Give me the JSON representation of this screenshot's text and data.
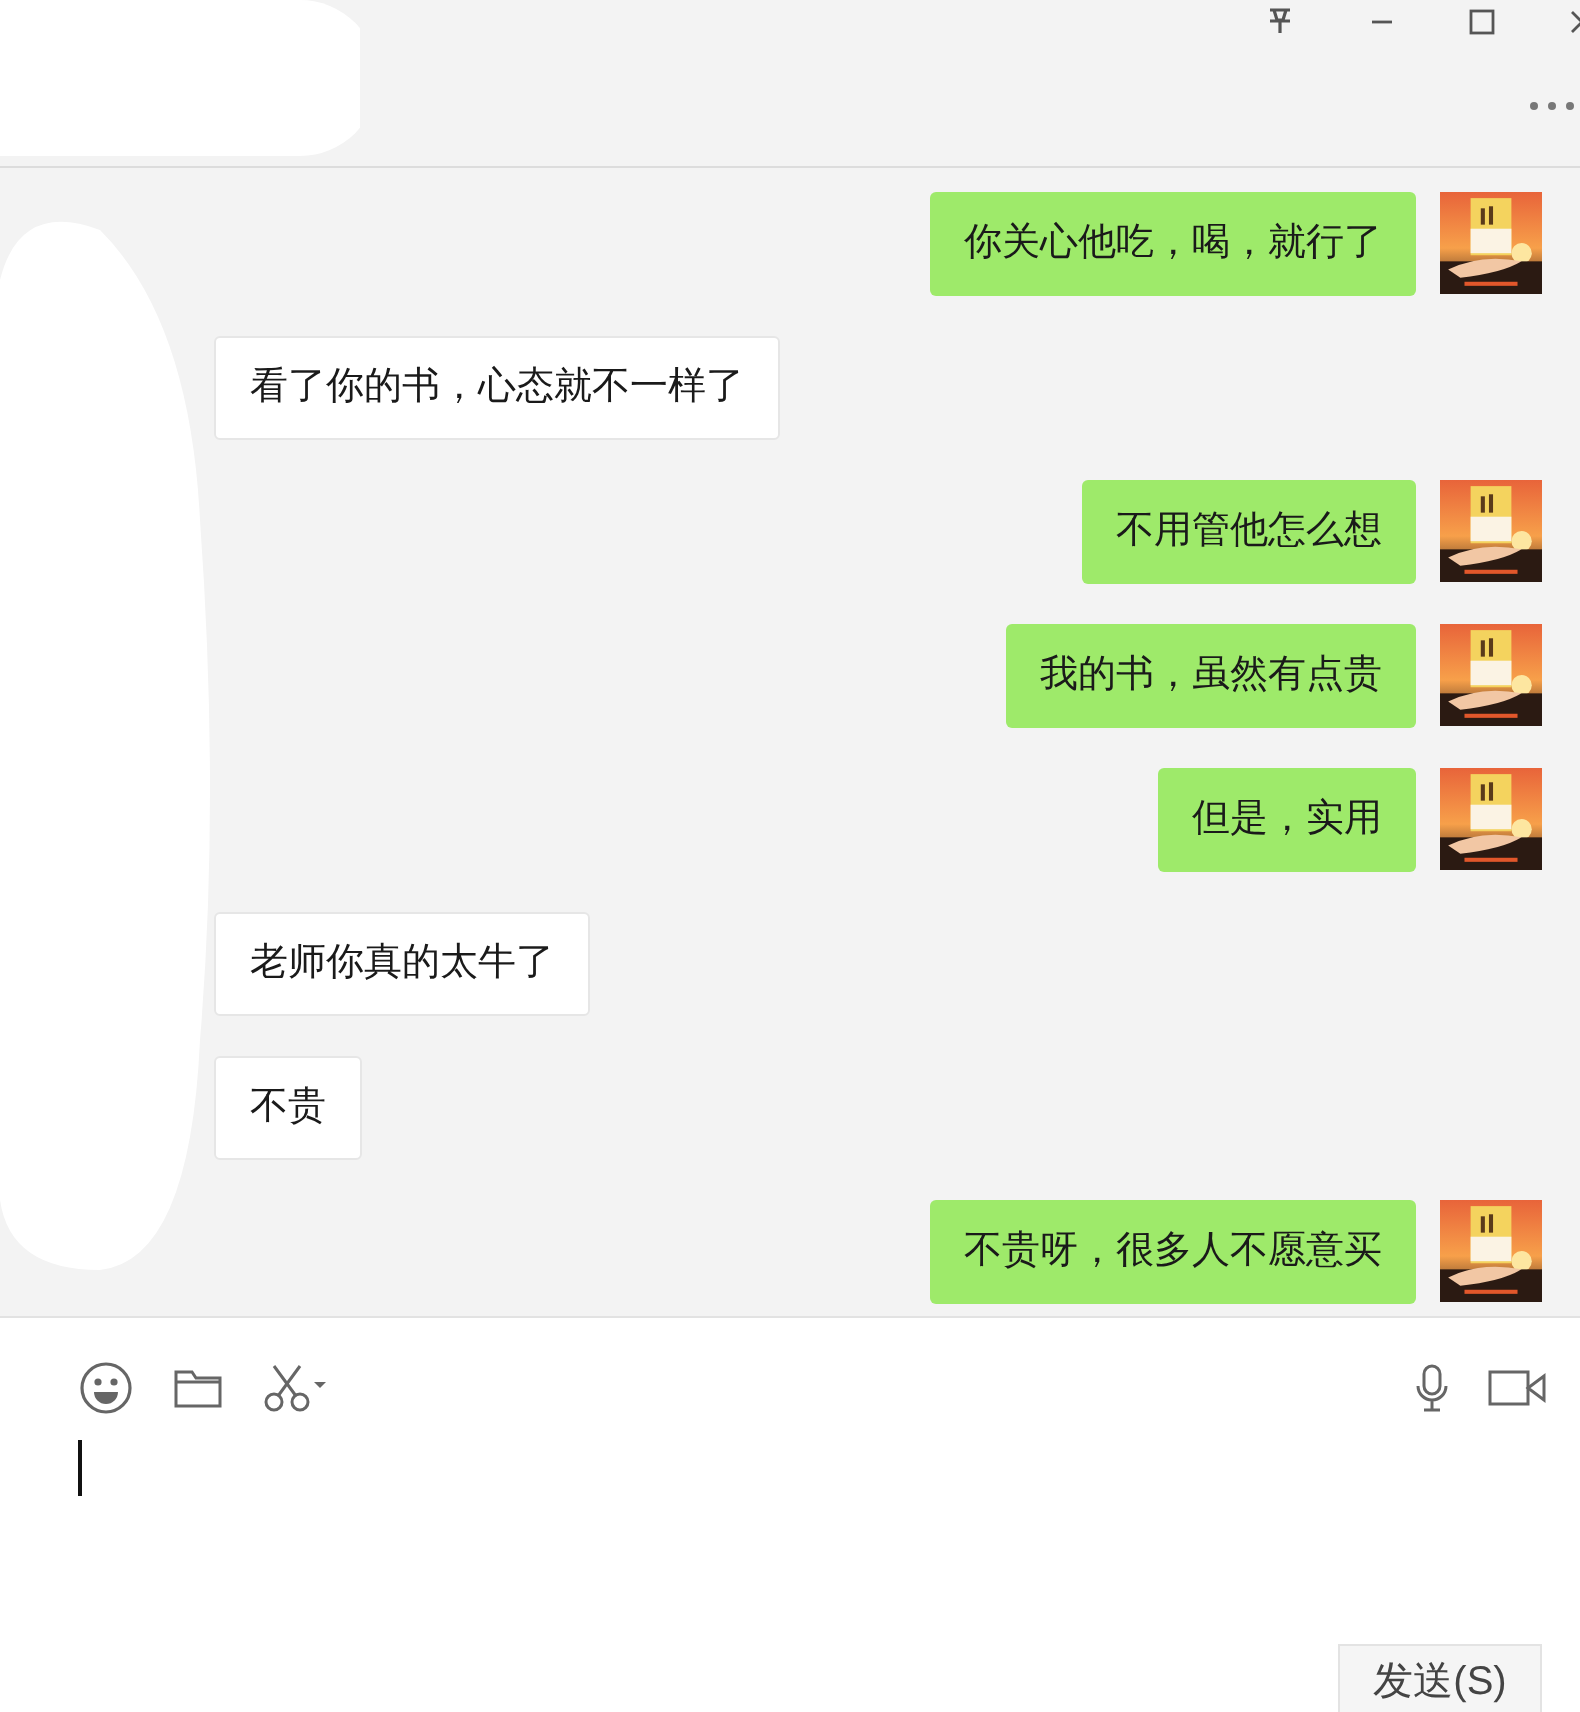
{
  "messages": [
    {
      "kind": "sent",
      "text": "你关心他吃，喝，就行了"
    },
    {
      "kind": "received",
      "text": "看了你的书，心态就不一样了"
    },
    {
      "kind": "sent",
      "text": "不用管他怎么想"
    },
    {
      "kind": "sent",
      "text": "我的书，虽然有点贵"
    },
    {
      "kind": "sent",
      "text": "但是，实用"
    },
    {
      "kind": "received",
      "text": "老师你真的太牛了"
    },
    {
      "kind": "received",
      "text": "不贵"
    },
    {
      "kind": "sent",
      "text": "不贵呀，很多人不愿意买"
    }
  ],
  "send_button": "发送(S)"
}
